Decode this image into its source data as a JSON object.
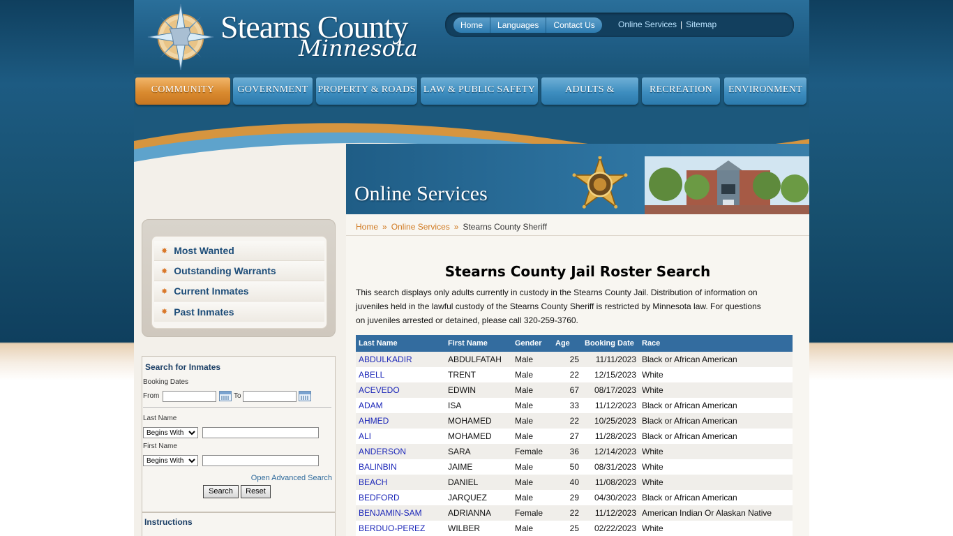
{
  "header": {
    "title": "Stearns County",
    "subtitle": "Minnesota",
    "top_links": [
      {
        "label": "Home"
      },
      {
        "label": "Languages"
      },
      {
        "label": "Contact Us"
      }
    ],
    "right_links": [
      {
        "label": "Online Services"
      },
      {
        "label": "Sitemap"
      }
    ],
    "right_sep": "|"
  },
  "main_nav": {
    "tabs": [
      {
        "label": "COMMUNITY",
        "active": true
      },
      {
        "label": "GOVERNMENT"
      },
      {
        "label": "PROPERTY & ROADS"
      },
      {
        "label": "LAW & PUBLIC SAFETY"
      },
      {
        "label": "ADULTS & FAMILIES"
      },
      {
        "label": "RECREATION"
      },
      {
        "label": "ENVIRONMENT"
      }
    ]
  },
  "banner": {
    "title": "Online Services"
  },
  "breadcrumb": {
    "items": [
      "Home",
      "Online Services"
    ],
    "current": "Stearns County Sheriff",
    "sep": "»"
  },
  "sidebar": {
    "items": [
      {
        "label": "Most Wanted"
      },
      {
        "label": "Outstanding Warrants"
      },
      {
        "label": "Current Inmates"
      },
      {
        "label": "Past Inmates"
      }
    ]
  },
  "search": {
    "heading": "Search for Inmates",
    "booking_dates_label": "Booking Dates",
    "from_label": "From",
    "to_label": "To",
    "from_value": "",
    "to_value": "",
    "last_name_label": "Last Name",
    "first_name_label": "First Name",
    "match_selected": "Begins With",
    "last_name_value": "",
    "first_name_value": "",
    "advanced_link": "Open Advanced Search",
    "search_button": "Search",
    "reset_button": "Reset"
  },
  "instructions": {
    "heading": "Instructions"
  },
  "main": {
    "title": "Stearns County Jail Roster Search",
    "intro": "This search displays only adults currently in custody in the Stearns County Jail. Distribution of information on juveniles held in the lawful custody of the Stearns County Sheriff is restricted by Minnesota law. For questions on juveniles arrested or detained, please call 320-259-3760.",
    "table": {
      "headers": [
        "Last Name",
        "First Name",
        "Gender",
        "Age",
        "Booking Date",
        "Race"
      ],
      "rows": [
        [
          "ABDULKADIR",
          "ABDULFATAH",
          "Male",
          "25",
          "11/11/2023",
          "Black or African American"
        ],
        [
          "ABELL",
          "TRENT",
          "Male",
          "22",
          "12/15/2023",
          "White"
        ],
        [
          "ACEVEDO",
          "EDWIN",
          "Male",
          "67",
          "08/17/2023",
          "White"
        ],
        [
          "ADAM",
          "ISA",
          "Male",
          "33",
          "11/12/2023",
          "Black or African American"
        ],
        [
          "AHMED",
          "MOHAMED",
          "Male",
          "22",
          "10/25/2023",
          "Black or African American"
        ],
        [
          "ALI",
          "MOHAMED",
          "Male",
          "27",
          "11/28/2023",
          "Black or African American"
        ],
        [
          "ANDERSON",
          "SARA",
          "Female",
          "36",
          "12/14/2023",
          "White"
        ],
        [
          "BALINBIN",
          "JAIME",
          "Male",
          "50",
          "08/31/2023",
          "White"
        ],
        [
          "BEACH",
          "DANIEL",
          "Male",
          "40",
          "11/08/2023",
          "White"
        ],
        [
          "BEDFORD",
          "JARQUEZ",
          "Male",
          "29",
          "04/30/2023",
          "Black or African American"
        ],
        [
          "BENJAMIN-SAM",
          "ADRIANNA",
          "Female",
          "22",
          "11/12/2023",
          "American Indian Or Alaskan Native"
        ],
        [
          "BERDUO-PEREZ",
          "WILBER",
          "Male",
          "25",
          "02/22/2023",
          "White"
        ]
      ]
    }
  },
  "colors": {
    "accent_orange": "#d98a2f",
    "nav_blue": "#3d8dbf",
    "table_header": "#336c9f",
    "link_blue": "#1b26b8"
  },
  "icons": {
    "logo": "compass-star-icon",
    "badge": "sheriff-star-badge-icon",
    "calendar": "calendar-icon",
    "bullet": "bullet-dot-icon"
  }
}
